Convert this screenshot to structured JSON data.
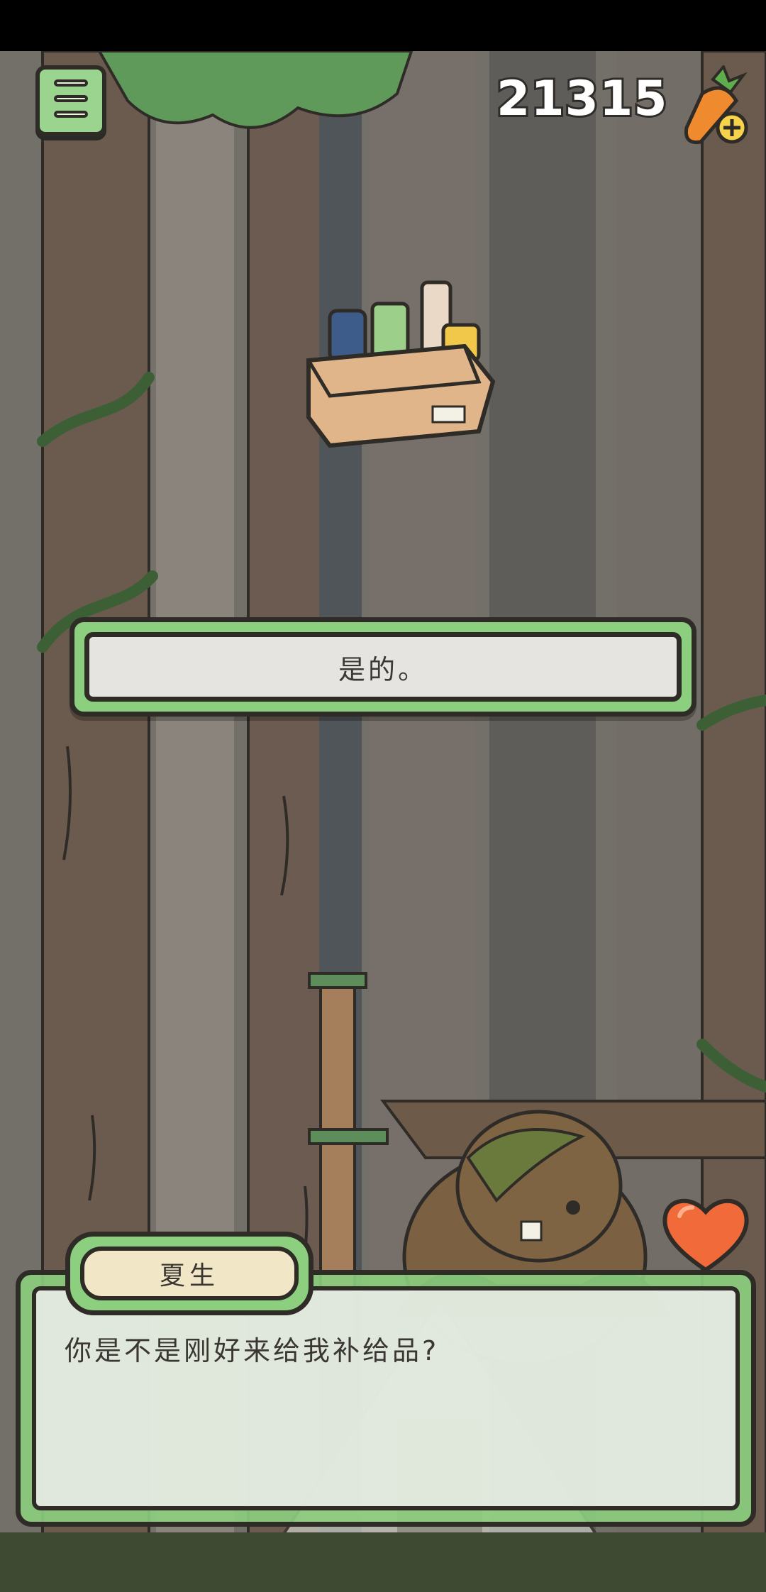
{
  "header": {
    "carrot_count": "21315",
    "menu_icon": "menu-icon",
    "carrot_icon": "carrot-add-icon"
  },
  "choices": [
    {
      "label": "是的。"
    }
  ],
  "dialog": {
    "speaker": "夏生",
    "text": "你是不是刚好来给我补给品?"
  },
  "colors": {
    "panel_green": "#8ccf7e",
    "outline": "#2f2c28",
    "choice_bg": "#e6e4e0",
    "name_plate": "#f1e6c6",
    "heart": "#f06a3a"
  }
}
